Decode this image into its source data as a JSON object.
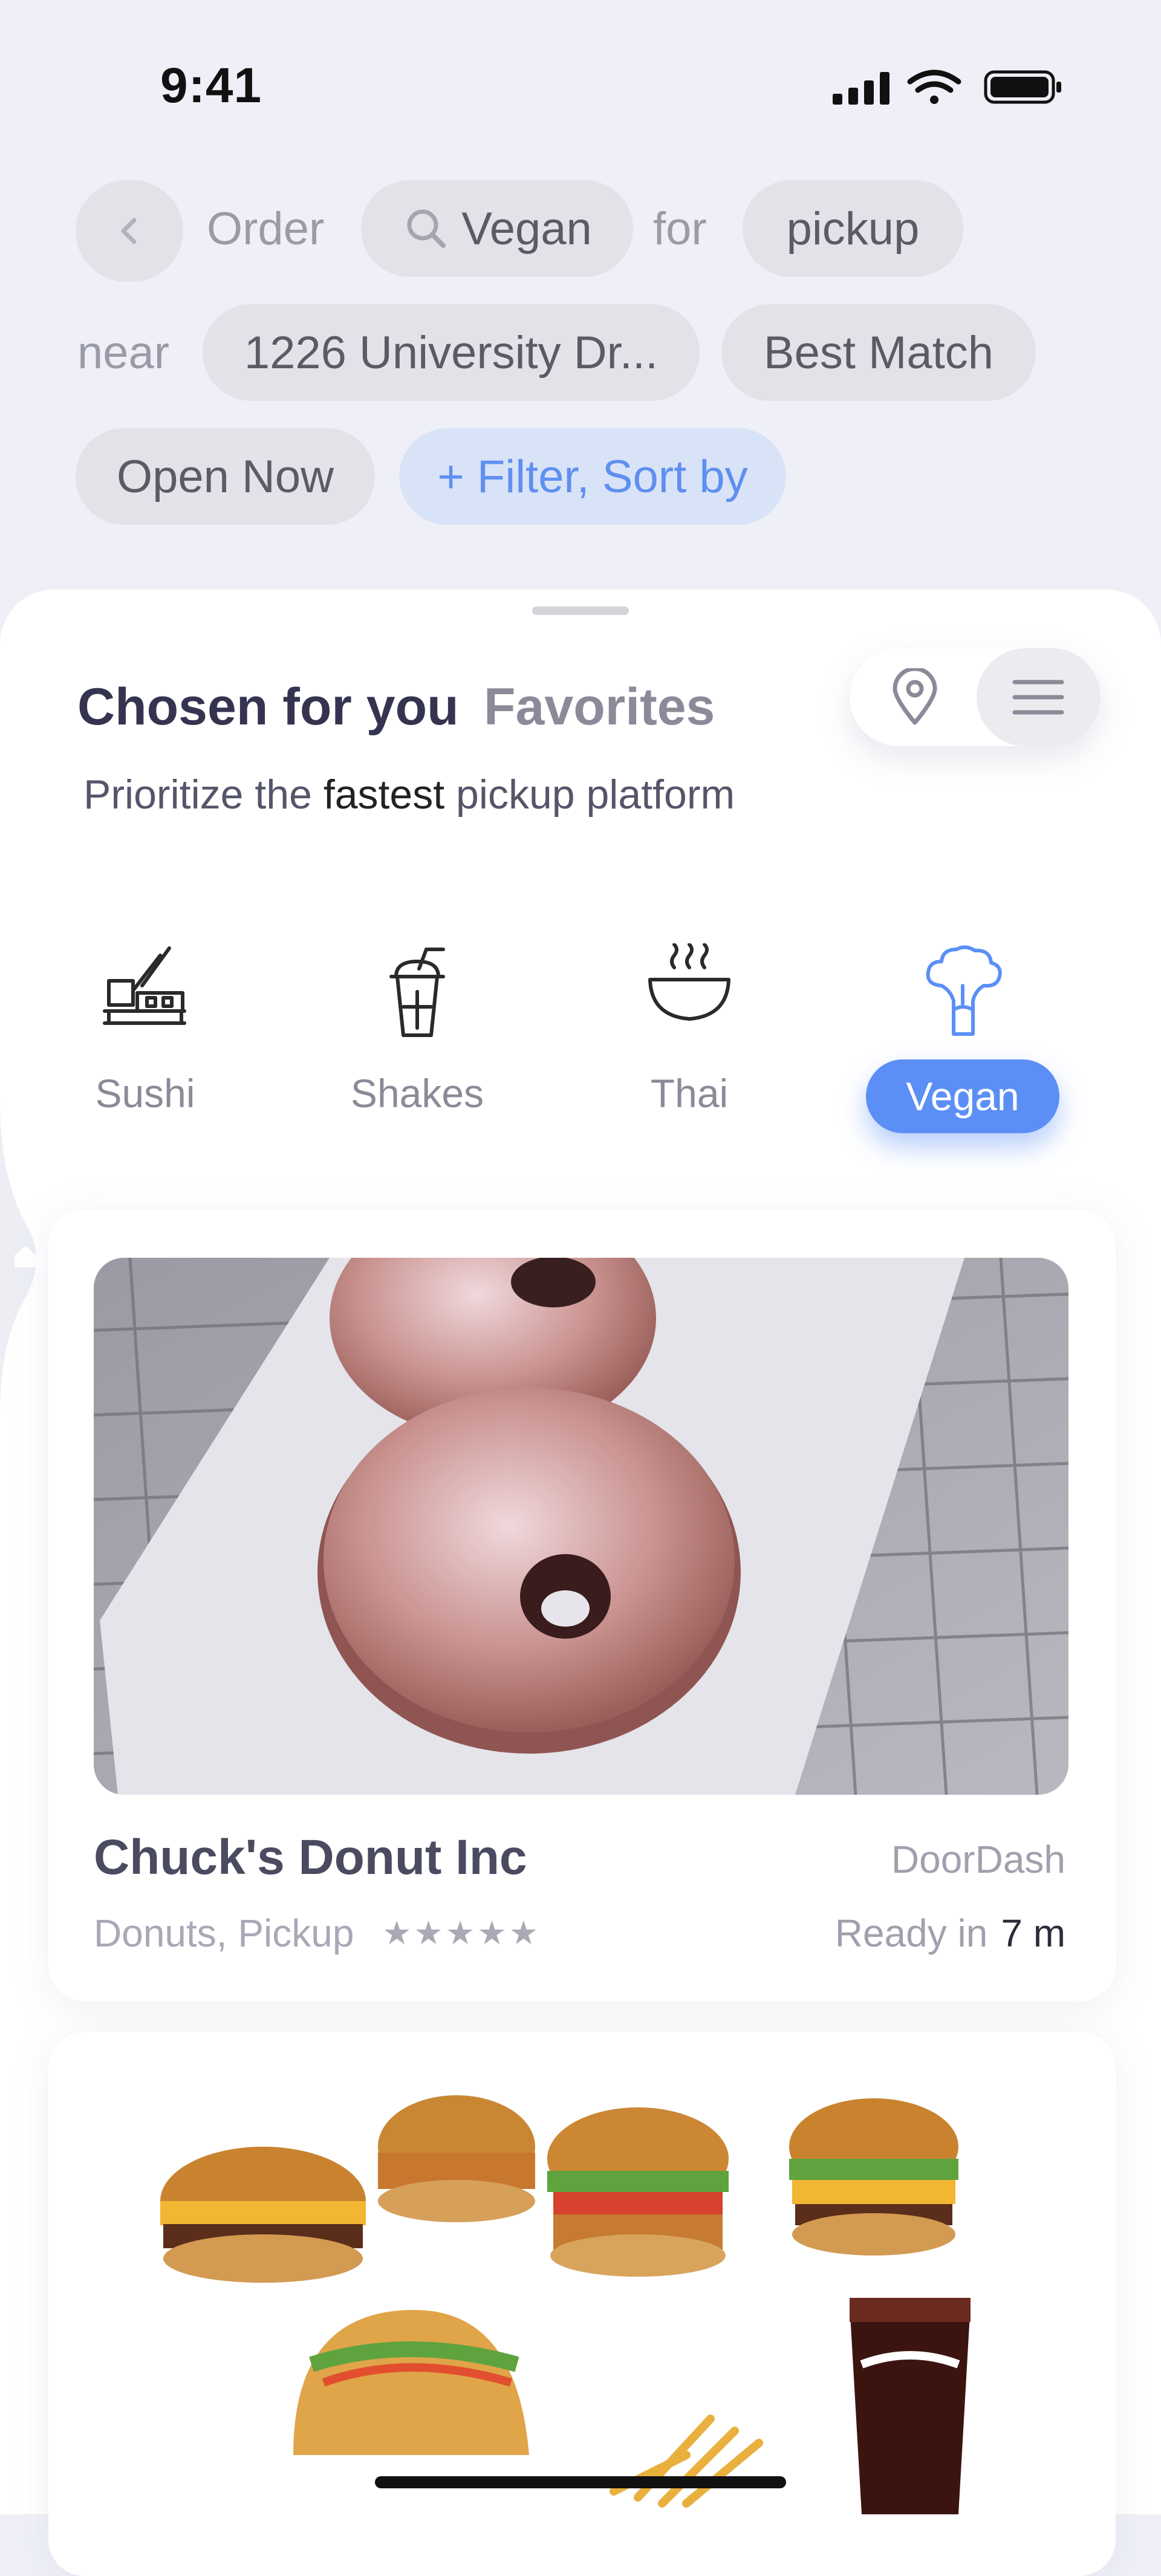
{
  "status_bar": {
    "time": "9:41"
  },
  "query": {
    "back_icon": "chevron-left-icon",
    "word_order": "Order",
    "search_value": "Vegan",
    "word_for": "for",
    "mode": "pickup",
    "word_near": "near",
    "address": "1226 University Dr...",
    "sort": "Best Match",
    "open_now": "Open Now",
    "filter": "+ Filter, Sort by",
    "filter_color": "#5f8ff0"
  },
  "sheet": {
    "tab_active": "Chosen for you",
    "tab_inactive": "Favorites",
    "subtitle_prefix": "Prioritize the ",
    "subtitle_emphasis": "fastest",
    "subtitle_suffix": " pickup platform",
    "view_toggle": {
      "map_icon": "map-pin-icon",
      "list_icon": "list-icon",
      "selected": "list"
    }
  },
  "categories": [
    {
      "label": "Sushi",
      "icon": "sushi-icon",
      "selected": false
    },
    {
      "label": "Shakes",
      "icon": "shake-cup-icon",
      "selected": false
    },
    {
      "label": "Thai",
      "icon": "soup-bowl-icon",
      "selected": false
    },
    {
      "label": "Vegan",
      "icon": "broccoli-icon",
      "selected": true
    }
  ],
  "accent_color": "#5b8ff5",
  "restaurants": [
    {
      "name": "Chuck's Donut Inc",
      "platform": "DoorDash",
      "tags": "Donuts, Pickup",
      "rating_stars": 5,
      "stars_text": "★★★★★",
      "ready_label": "Ready in",
      "ready_time": "7 m",
      "photo": "glazed donuts on cooling rack"
    },
    {
      "photo": "burgers, tacos and cola"
    }
  ]
}
